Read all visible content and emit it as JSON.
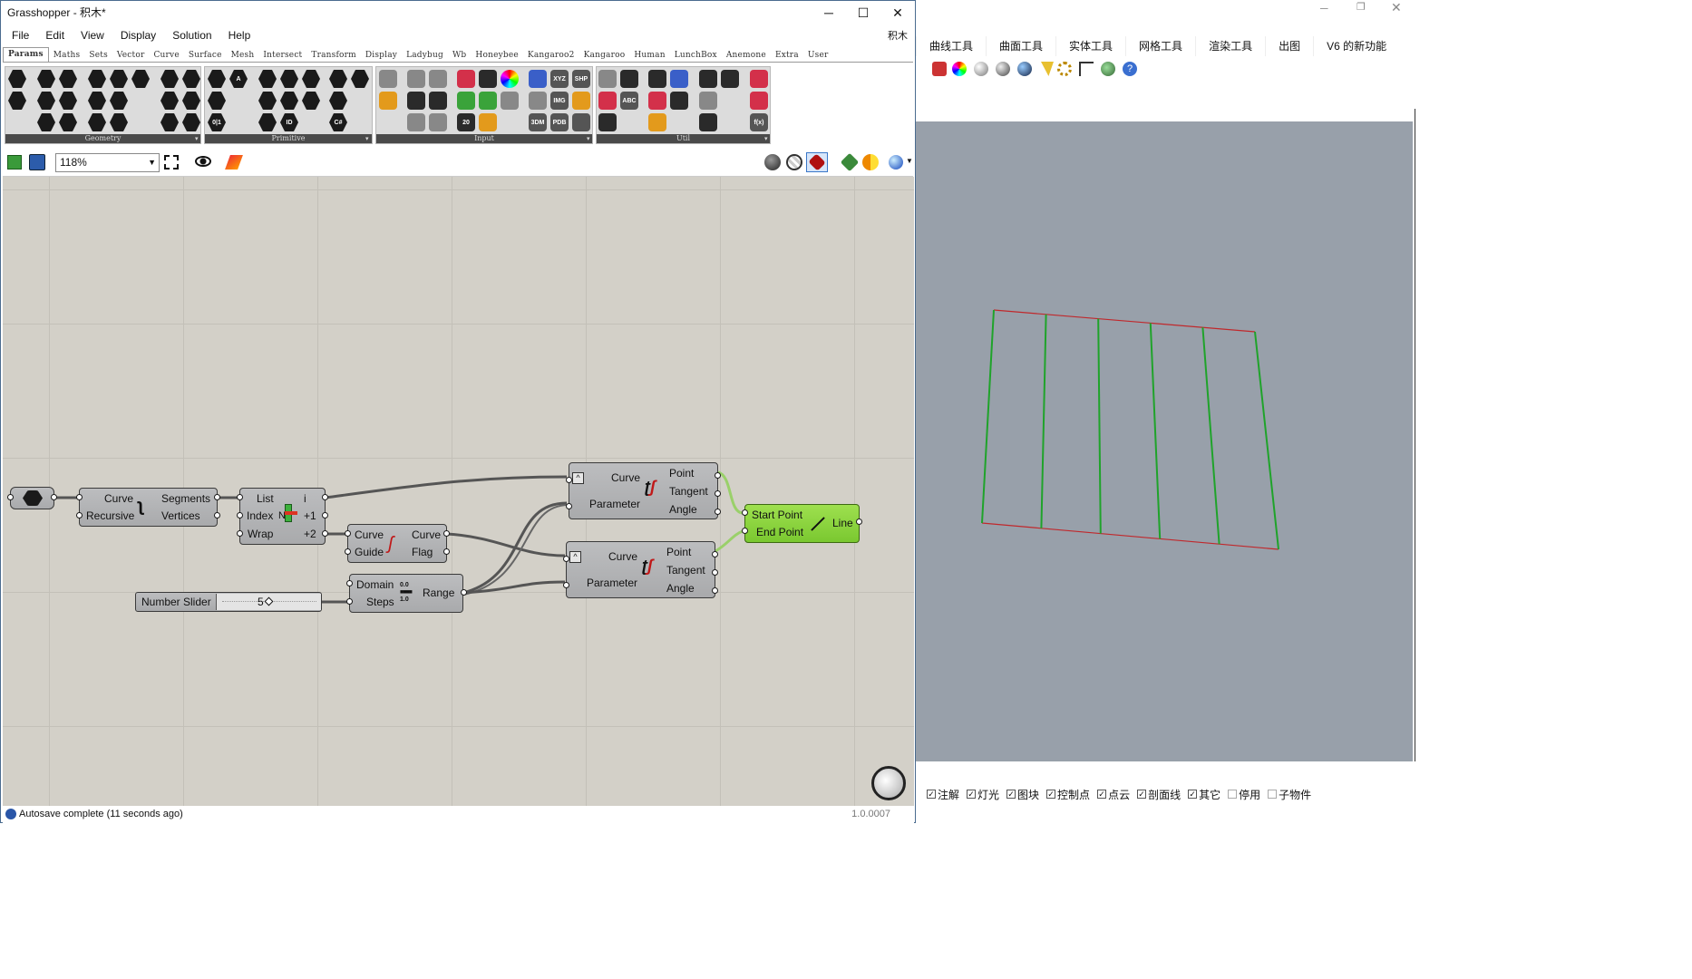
{
  "gh": {
    "title": "Grasshopper - 积木*",
    "menu": [
      "File",
      "Edit",
      "View",
      "Display",
      "Solution",
      "Help"
    ],
    "menu_right": "积木",
    "tabs": [
      "Params",
      "Maths",
      "Sets",
      "Vector",
      "Curve",
      "Surface",
      "Mesh",
      "Intersect",
      "Transform",
      "Display",
      "Ladybug",
      "Wb",
      "Honeybee",
      "Kangaroo2",
      "Kangaroo",
      "Human",
      "LunchBox",
      "Anemone",
      "Extra",
      "User"
    ],
    "panels": [
      "Geometry",
      "Primitive",
      "Input",
      "Util"
    ],
    "zoom": "118%",
    "status": "Autosave complete (11 seconds ago)",
    "version": "1.0.0007",
    "icon_labels": {
      "xyz": "XYZ",
      "shp": "SHP",
      "img": "IMG",
      "pdb": "PDB",
      "d3": "3DM",
      "aug": "AUG",
      "n20": "20",
      "abc": "ABC",
      "fx": "f(x)",
      "c": "C#",
      "id": "ID",
      "a": "A",
      "zeroone": "0|1"
    }
  },
  "nodes": {
    "explode": {
      "in": [
        "Curve",
        "Recursive"
      ],
      "out": [
        "Segments",
        "Vertices"
      ]
    },
    "list": {
      "in": [
        "List",
        "Index",
        "Wrap"
      ],
      "out": [
        "i",
        "+1",
        "+2"
      ],
      "index_n": "N"
    },
    "flip": {
      "in": [
        "Curve",
        "Guide"
      ],
      "out": [
        "Curve",
        "Flag"
      ]
    },
    "range": {
      "in": [
        "Domain",
        "Steps"
      ],
      "out": [
        "Range"
      ],
      "icon_top": "0.0",
      "icon_bot": "1.0"
    },
    "eval1": {
      "in": [
        "Curve",
        "Parameter"
      ],
      "out": [
        "Point",
        "Tangent",
        "Angle"
      ]
    },
    "eval2": {
      "in": [
        "Curve",
        "Parameter"
      ],
      "out": [
        "Point",
        "Tangent",
        "Angle"
      ]
    },
    "line": {
      "in": [
        "Start Point",
        "End Point"
      ],
      "out": [
        "Line"
      ]
    },
    "slider": {
      "label": "Number Slider",
      "value": "5",
      "value_num": 5
    }
  },
  "rhino": {
    "tabs": [
      "曲线工具",
      "曲面工具",
      "实体工具",
      "网格工具",
      "渲染工具",
      "出图",
      "V6 的新功能"
    ],
    "layers": [
      {
        "label": "注解",
        "checked": true
      },
      {
        "label": "灯光",
        "checked": true
      },
      {
        "label": "图块",
        "checked": true
      },
      {
        "label": "控制点",
        "checked": true
      },
      {
        "label": "点云",
        "checked": true
      },
      {
        "label": "剖面线",
        "checked": true
      },
      {
        "label": "其它",
        "checked": true
      },
      {
        "label": "停用",
        "checked": false
      },
      {
        "label": "子物件",
        "checked": false
      }
    ],
    "line_color": "#1fa32a",
    "outline_color": "#c0282c"
  },
  "colors": {
    "canvas": "#d3d0c8",
    "node": "#b2b3b5",
    "node_green": "#8dd640",
    "wire": "#555555",
    "wire_green": "#9ad06a"
  }
}
